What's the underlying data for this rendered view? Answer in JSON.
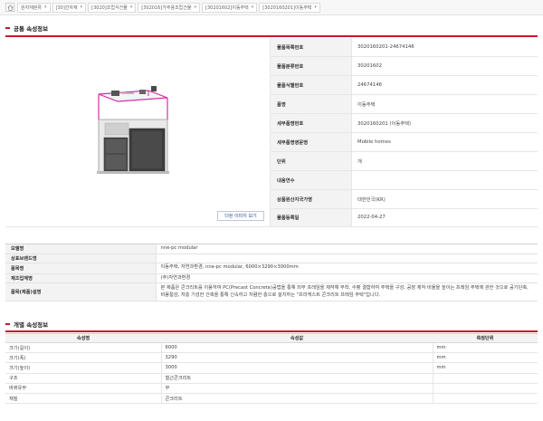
{
  "breadcrumb": {
    "items": [
      "원자재분류",
      "[30]건자재",
      "[3020]조립식건물",
      "[302016]가주용조립건물",
      "[30201602]이동주택",
      "[3020160201]이동주택"
    ]
  },
  "common_section": {
    "title": "공통 속성정보",
    "view_large_image_label": "더된 이미지 보기",
    "rows": [
      {
        "label": "물품목록번호",
        "value": "3020160201-24674146"
      },
      {
        "label": "물품분류번호",
        "value": "30201602"
      },
      {
        "label": "물품식별번호",
        "value": "24674146"
      },
      {
        "label": "품명",
        "value": "이동주택"
      },
      {
        "label": "세부품명번호",
        "value": "3020160201 (이동주택)"
      },
      {
        "label": "세부품명영문명",
        "value": "Mobile homes"
      },
      {
        "label": "단위",
        "value": "개"
      },
      {
        "label": "내용연수",
        "value": ""
      },
      {
        "label": "상품원산지국가명",
        "value": "대한민국(KR)"
      },
      {
        "label": "물품등록일",
        "value": "2022-04-27"
      }
    ]
  },
  "spec_rows": [
    {
      "label": "모델명",
      "value": "nne-pc modular"
    },
    {
      "label": "상표브랜드명",
      "value": ""
    },
    {
      "label": "품목명",
      "value": "이동주택, 자연과환경, nne-pc modular, 6000×3290×3000mm"
    },
    {
      "label": "제조업체명",
      "value": "(주)자연과환경"
    },
    {
      "label": "품목(제품)설명",
      "value": "본 제품은 콘크리트를 이용하여 PC(Precast Concrete)공법을 통해 외부 프레임을 제작해 부착, 수평 결합하여 주택을 구성, 공장 제작 비율을 높이는 프레임 주택에 관한 것으로 공기단축, 비용절감, 저층 기성한 건축을 통해 신속하고 저렴한 층으로 설치하는 \"프리캐스트 콘크리트 프레임 주택\"입니다."
    }
  ],
  "individual_section": {
    "title": "개별 속성정보",
    "headers": [
      "속성명",
      "속성값",
      "측정단위"
    ],
    "rows": [
      {
        "name": "크기(길이)",
        "value": "6000",
        "unit": "mm"
      },
      {
        "name": "크기(폭)",
        "value": "3290",
        "unit": "mm"
      },
      {
        "name": "크기(높이)",
        "value": "3000",
        "unit": "mm"
      },
      {
        "name": "구조",
        "value": "철근콘크리트",
        "unit": ""
      },
      {
        "name": "바퀴유무",
        "value": "무",
        "unit": ""
      },
      {
        "name": "재질",
        "value": "콘크리트",
        "unit": ""
      }
    ]
  },
  "colors": {
    "accent_red": "#c8162a",
    "label_bg": "#f3f3f3",
    "frame_magenta": "#d12fa6"
  }
}
